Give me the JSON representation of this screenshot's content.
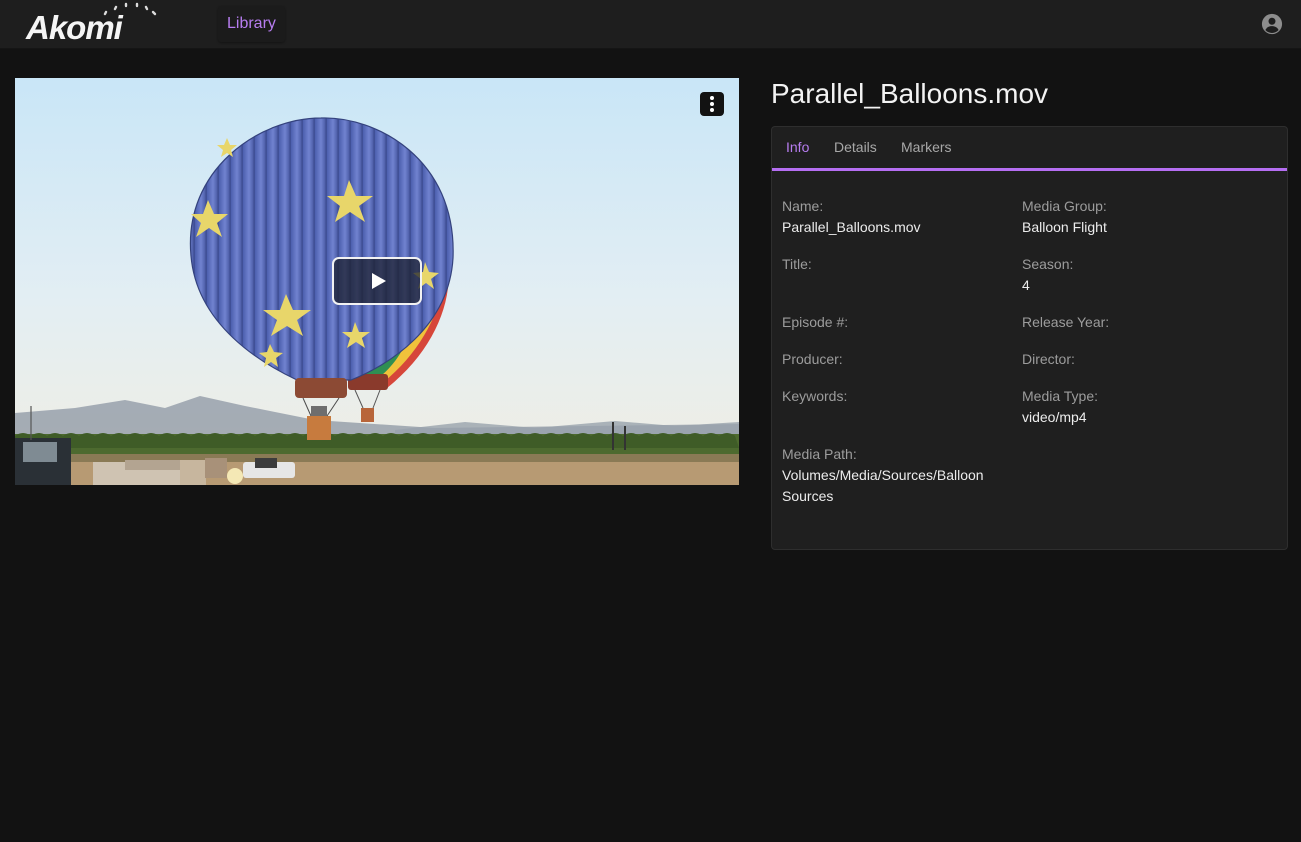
{
  "app": {
    "logo_text": "Akomi",
    "nav": {
      "library_label": "Library"
    },
    "accent_color": "#b56ef2"
  },
  "icons": {
    "account": "account-circle-icon",
    "more": "more-vertical-icon",
    "play": "play-icon"
  },
  "video": {
    "file_name": "Parallel_Balloons.mov"
  },
  "tabs": [
    {
      "label": "Info",
      "active": true
    },
    {
      "label": "Details",
      "active": false
    },
    {
      "label": "Markers",
      "active": false
    }
  ],
  "info": {
    "name": {
      "label": "Name:",
      "value": "Parallel_Balloons.mov"
    },
    "media_group": {
      "label": "Media Group:",
      "value": "Balloon Flight"
    },
    "title": {
      "label": "Title:",
      "value": ""
    },
    "season": {
      "label": "Season:",
      "value": "4"
    },
    "episode": {
      "label": "Episode #:",
      "value": ""
    },
    "release_year": {
      "label": "Release Year:",
      "value": ""
    },
    "producer": {
      "label": "Producer:",
      "value": ""
    },
    "director": {
      "label": "Director:",
      "value": ""
    },
    "keywords": {
      "label": "Keywords:",
      "value": ""
    },
    "media_type": {
      "label": "Media Type:",
      "value": "video/mp4"
    },
    "media_path": {
      "label": "Media Path:",
      "value": "Volumes/Media/Sources/Balloon Sources"
    }
  }
}
